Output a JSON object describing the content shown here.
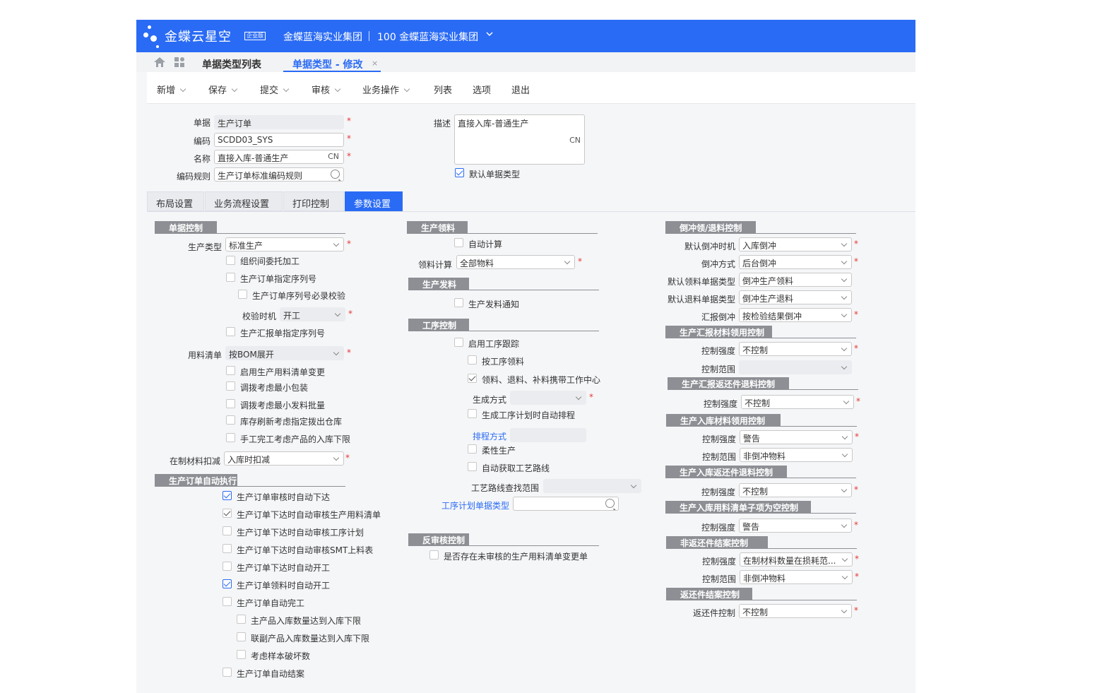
{
  "header": {
    "logo_text": "金蝶云星空",
    "logo_badge": "企业版",
    "org_name": "金蝶蓝海实业集团",
    "org_code": "100 金蝶蓝海实业集团"
  },
  "page_tabs": {
    "list_label": "单据类型列表",
    "edit_label": "单据类型 - 修改",
    "close": "×"
  },
  "toolbar": {
    "new": "新增",
    "save": "保存",
    "submit": "提交",
    "audit": "审核",
    "biz_ops": "业务操作",
    "list": "列表",
    "options": "选项",
    "exit": "退出"
  },
  "form": {
    "bill_label": "单据",
    "bill_value": "生产订单",
    "code_label": "编码",
    "code_value": "SCDD03_SYS",
    "name_label": "名称",
    "name_value": "直接入库-普通生产",
    "name_lang": "CN",
    "rule_label": "编码规则",
    "rule_value": "生产订单标准编码规则",
    "desc_label": "描述",
    "desc_value": "直接入库-普通生产",
    "desc_lang": "CN",
    "default_type_label": "默认单据类型",
    "required": "*"
  },
  "setting_tabs": [
    "布局设置",
    "业务流程设置",
    "打印控制",
    "参数设置"
  ],
  "col1": {
    "sec_bill_ctrl": "单据控制",
    "prod_type_label": "生产类型",
    "prod_type_value": "标准生产",
    "cb_outsource": "组织间委托加工",
    "cb_seq": "生产订单指定序列号",
    "cb_seq_check": "生产订单序列号必录校验",
    "check_time_label": "校验时机",
    "check_time_value": "开工",
    "cb_report_seq": "生产汇报单指定序列号",
    "bom_label": "用料清单",
    "bom_value": "按BOM展开",
    "cb_bom_change": "启用生产用料清单变更",
    "cb_min_pack": "调拨考虑最小包装",
    "cb_min_issue": "调拨考虑最小发料批量",
    "cb_refresh": "库存刷新考虑指定拨出仓库",
    "cb_manual": "手工完工考虑产品的入库下限",
    "wip_label": "在制材料扣减",
    "wip_value": "入库时扣减",
    "sec_auto": "生产订单自动执行",
    "cb_a1": "生产订单审核时自动下达",
    "cb_a2": "生产订单下达时自动审核生产用料清单",
    "cb_a3": "生产订单下达时自动审核工序计划",
    "cb_a4": "生产订单下达时自动审核SMT上料表",
    "cb_a5": "生产订单下达时自动开工",
    "cb_a6": "生产订单领料时自动开工",
    "cb_a7": "生产订单自动完工",
    "cb_a8": "主产品入库数量达到入库下限",
    "cb_a9": "联副产品入库数量达到入库下限",
    "cb_a10": "考虑样本破坏数",
    "cb_a11": "生产订单自动结案"
  },
  "col2": {
    "sec_pick": "生产领料",
    "cb_auto_calc": "自动计算",
    "pick_calc_label": "领料计算",
    "pick_calc_value": "全部物料",
    "sec_issue": "生产发料",
    "cb_issue_notice": "生产发料通知",
    "sec_op": "工序控制",
    "cb_op_track": "启用工序跟踪",
    "cb_op_pick": "按工序领料",
    "cb_carry": "领料、退料、补料携带工作中心",
    "gen_mode_label": "生成方式",
    "gen_mode_value": "",
    "cb_auto_sched": "生成工序计划时自动排程",
    "sched_label": "排程方式",
    "sched_value": "",
    "cb_flex": "柔性生产",
    "cb_route": "自动获取工艺路线",
    "route_range_label": "工艺路线查找范围",
    "route_range_value": "",
    "op_plan_label": "工序计划单据类型",
    "op_plan_value": "",
    "sec_unaudit": "反审核控制",
    "cb_unaudit": "是否存在未审核的生产用料清单变更单"
  },
  "col3": {
    "sec_backflush": "倒冲领/退料控制",
    "bf_time_label": "默认倒冲时机",
    "bf_time_value": "入库倒冲",
    "bf_mode_label": "倒冲方式",
    "bf_mode_value": "后台倒冲",
    "bf_pick_label": "默认领料单据类型",
    "bf_pick_value": "倒冲生产领料",
    "bf_return_label": "默认退料单据类型",
    "bf_return_value": "倒冲生产退料",
    "bf_report_label": "汇报倒冲",
    "bf_report_value": "按检验结果倒冲",
    "sec_rpt_mat": "生产汇报材料领用控制",
    "rm_strength_label": "控制强度",
    "rm_strength_value": "不控制",
    "rm_range_label": "控制范围",
    "rm_range_value": "",
    "sec_rpt_ret": "生产汇报返还件退料控制",
    "rr_strength_label": "控制强度",
    "rr_strength_value": "不控制",
    "sec_in_mat": "生产入库材料领用控制",
    "im_strength_label": "控制强度",
    "im_strength_value": "警告",
    "im_range_label": "控制范围",
    "im_range_value": "非倒冲物料",
    "sec_in_ret": "生产入库返还件退料控制",
    "ir_strength_label": "控制强度",
    "ir_strength_value": "不控制",
    "sec_in_bom": "生产入库用料清单子项为空控制",
    "ib_strength_label": "控制强度",
    "ib_strength_value": "警告",
    "sec_nonret": "非返还件结案控制",
    "nr_strength_label": "控制强度",
    "nr_strength_value": "在制材料数量在损耗范...",
    "nr_range_label": "控制范围",
    "nr_range_value": "非倒冲物料",
    "sec_ret_close": "返还件结案控制",
    "rc_label": "返还件控制",
    "rc_value": "不控制"
  },
  "colors": {
    "accent": "#2a6bf5",
    "section": "#8d8f94",
    "required": "#e53935"
  }
}
